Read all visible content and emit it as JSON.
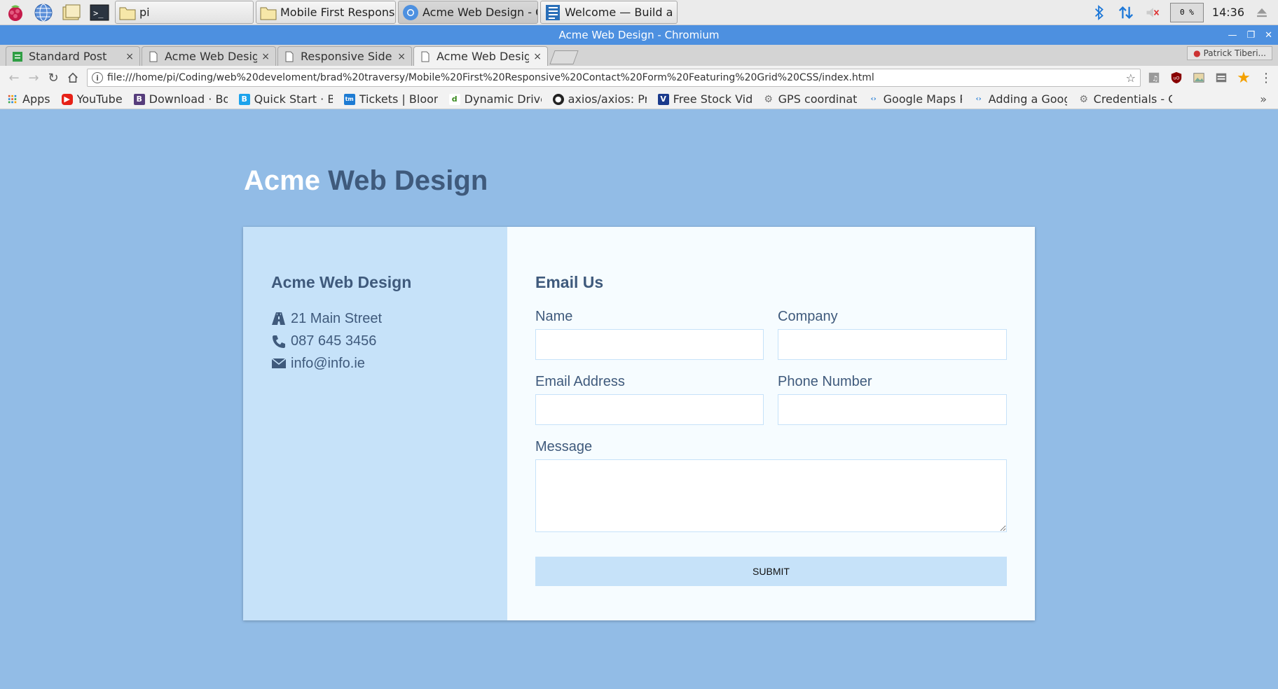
{
  "taskbar": {
    "tasks": [
      {
        "label": "pi"
      },
      {
        "label": "Mobile First Responsi..."
      },
      {
        "label": "Acme Web Design - C..."
      },
      {
        "label": "Welcome — Build a R..."
      }
    ],
    "cpu": "0 %",
    "clock": "14:36"
  },
  "window": {
    "title": "Acme Web Design - Chromium"
  },
  "tabs": [
    {
      "label": "Standard Post",
      "close": "×"
    },
    {
      "label": "Acme Web Design",
      "close": "×"
    },
    {
      "label": "Responsive Side M",
      "close": "×"
    },
    {
      "label": "Acme Web Design",
      "close": "×"
    }
  ],
  "profile": "Patrick Tiberi...",
  "address_bar": {
    "url": "file:///home/pi/Coding/web%20develoment/brad%20traversy/Mobile%20First%20Responsive%20Contact%20Form%20Featuring%20Grid%20CSS/index.html"
  },
  "bookmarks": [
    {
      "label": "Apps",
      "icon": "apps-grid-icon"
    },
    {
      "label": "YouTube",
      "icon": "youtube-icon"
    },
    {
      "label": "Download · Boo",
      "icon": "bootstrap-icon"
    },
    {
      "label": "Quick Start · Bo",
      "icon": "b-icon"
    },
    {
      "label": "Tickets | Bloom",
      "icon": "tm-icon"
    },
    {
      "label": "Dynamic Drive-",
      "icon": "dd-icon"
    },
    {
      "label": "axios/axios: Pro",
      "icon": "github-icon"
    },
    {
      "label": "Free Stock Vide",
      "icon": "v-icon"
    },
    {
      "label": "GPS coordinate",
      "icon": "gear-icon"
    },
    {
      "label": "Google Maps Pl",
      "icon": "code-icon"
    },
    {
      "label": "Adding a Googl",
      "icon": "code-icon"
    },
    {
      "label": "Credentials - Ga",
      "icon": "gear-icon"
    }
  ],
  "bookmarks_more": "»",
  "page": {
    "heading_part1": "Acme",
    "heading_part2": "Web Design",
    "company": {
      "title": "Acme Web Design",
      "address": "21 Main Street",
      "phone": "087 645 3456",
      "email": "info@info.ie"
    },
    "form": {
      "title": "Email Us",
      "name_label": "Name",
      "company_label": "Company",
      "email_label": "Email Address",
      "phone_label": "Phone Number",
      "message_label": "Message",
      "submit_label": "SUBMIT"
    }
  },
  "colors": {
    "page_bg": "#92bce6",
    "card_left_bg": "#c6e2f9",
    "card_right_bg": "#f6fcff",
    "brand_dark": "#3f5a7c",
    "title_bar": "#4d90e0"
  }
}
